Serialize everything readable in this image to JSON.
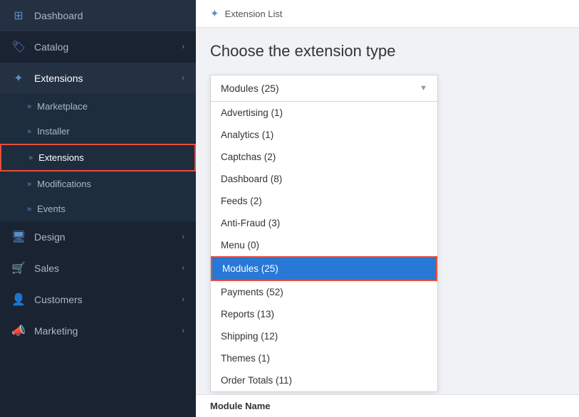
{
  "sidebar": {
    "items": [
      {
        "id": "dashboard",
        "label": "Dashboard",
        "icon": "⊞",
        "hasChevron": false
      },
      {
        "id": "catalog",
        "label": "Catalog",
        "icon": "🏷",
        "hasChevron": true
      },
      {
        "id": "extensions",
        "label": "Extensions",
        "icon": "🧩",
        "hasChevron": true,
        "active": true
      }
    ],
    "extensions_subitems": [
      {
        "id": "marketplace",
        "label": "Marketplace"
      },
      {
        "id": "installer",
        "label": "Installer"
      },
      {
        "id": "extensions-sub",
        "label": "Extensions",
        "highlighted": true
      },
      {
        "id": "modifications",
        "label": "Modifications"
      },
      {
        "id": "events",
        "label": "Events"
      }
    ],
    "bottom_items": [
      {
        "id": "design",
        "label": "Design",
        "icon": "🖥",
        "hasChevron": true
      },
      {
        "id": "sales",
        "label": "Sales",
        "icon": "🛒",
        "hasChevron": true
      },
      {
        "id": "customers",
        "label": "Customers",
        "icon": "👤",
        "hasChevron": true
      },
      {
        "id": "marketing",
        "label": "Marketing",
        "icon": "📣",
        "hasChevron": true
      }
    ]
  },
  "header": {
    "breadcrumb_icon": "🧩",
    "breadcrumb_text": "Extension List"
  },
  "main": {
    "page_title": "Choose the extension type",
    "dropdown": {
      "selected_label": "Modules (25)",
      "items": [
        {
          "id": "advertising",
          "label": "Advertising (1)",
          "selected": false
        },
        {
          "id": "analytics",
          "label": "Analytics (1)",
          "selected": false
        },
        {
          "id": "captchas",
          "label": "Captchas (2)",
          "selected": false
        },
        {
          "id": "dashboard",
          "label": "Dashboard (8)",
          "selected": false
        },
        {
          "id": "feeds",
          "label": "Feeds (2)",
          "selected": false
        },
        {
          "id": "anti-fraud",
          "label": "Anti-Fraud (3)",
          "selected": false
        },
        {
          "id": "menu",
          "label": "Menu (0)",
          "selected": false
        },
        {
          "id": "modules",
          "label": "Modules (25)",
          "selected": true
        },
        {
          "id": "payments",
          "label": "Payments (52)",
          "selected": false
        },
        {
          "id": "reports",
          "label": "Reports (13)",
          "selected": false
        },
        {
          "id": "shipping",
          "label": "Shipping (12)",
          "selected": false
        },
        {
          "id": "themes",
          "label": "Themes (1)",
          "selected": false
        },
        {
          "id": "order-totals",
          "label": "Order Totals (11)",
          "selected": false
        }
      ]
    },
    "bottom_label": "Module Name"
  }
}
